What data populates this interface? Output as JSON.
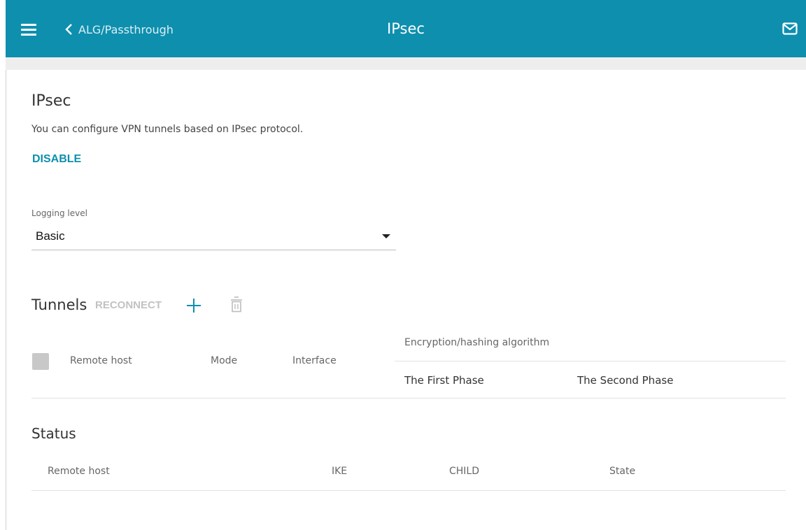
{
  "header": {
    "back_label": "ALG/Passthrough",
    "title": "IPsec",
    "icons": {
      "menu": "hamburger-menu-icon",
      "back": "chevron-left-icon",
      "mail": "envelope-icon"
    }
  },
  "ipsec": {
    "heading": "IPsec",
    "description": "You can configure VPN tunnels based on IPsec protocol.",
    "disable_label": "DISABLE"
  },
  "logging": {
    "label": "Logging level",
    "selected": "Basic"
  },
  "tunnels": {
    "heading": "Tunnels",
    "reconnect_label": "RECONNECT",
    "icons": {
      "add": "plus-icon",
      "delete": "trash-icon"
    },
    "columns": {
      "remote_host": "Remote host",
      "mode": "Mode",
      "interface": "Interface",
      "encryption": "Encryption/hashing algorithm",
      "first_phase": "The First Phase",
      "second_phase": "The Second Phase"
    }
  },
  "status": {
    "heading": "Status",
    "columns": [
      "Remote host",
      "IKE",
      "CHILD",
      "State"
    ]
  },
  "colors": {
    "accent": "#0e8fae",
    "disabled": "#c2c2c2"
  }
}
